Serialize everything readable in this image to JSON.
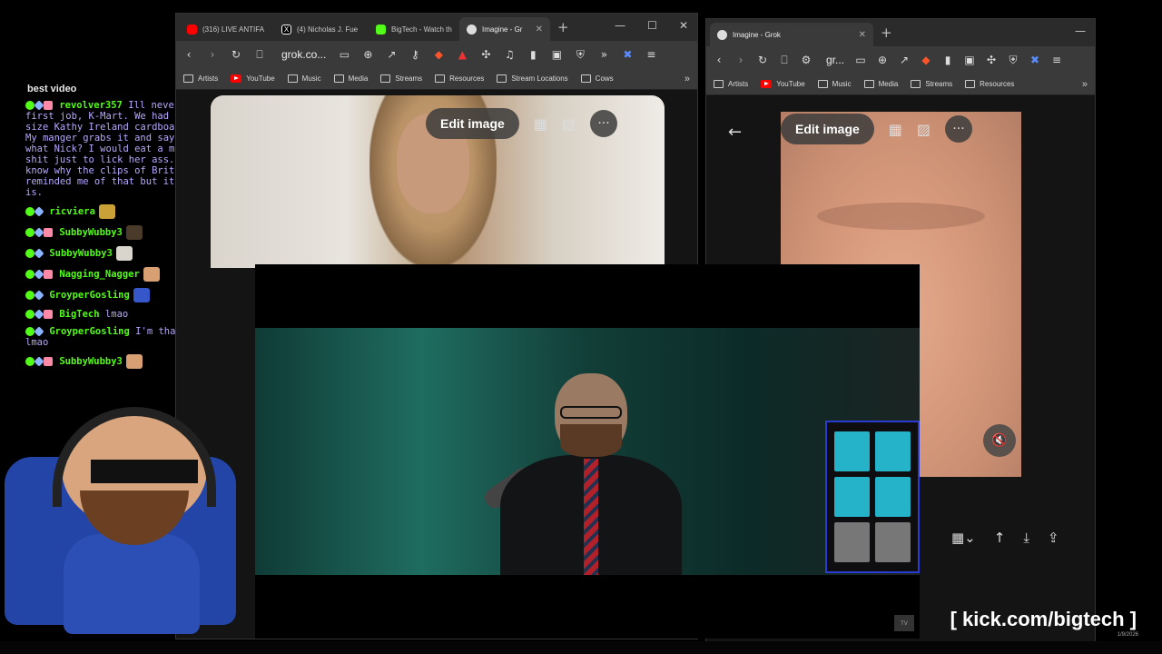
{
  "chat": {
    "header": "best video",
    "messages": [
      {
        "user": "revolver357",
        "text": "Ill never forget my first job, K-Mart. We had this life size Kathy Ireland cardboard cutout. My manger grabs it and says “you know what Nick? I would eat a mile of her shit just to lick her ass.” I don’t know why the clips of Brittany reminded me of that but it is what it is.",
        "emote": false
      },
      {
        "user": "ricviera",
        "text": "",
        "emote": true
      },
      {
        "user": "SubbyWubby3",
        "text": "",
        "emote": true
      },
      {
        "user": "SubbyWubby3",
        "text": "",
        "emote": true
      },
      {
        "user": "Nagging_Nagger",
        "text": "",
        "emote": true
      },
      {
        "user": "GroyperGosling",
        "text": "",
        "emote": true
      },
      {
        "user": "BigTech",
        "text": "lmao",
        "emote": false
      },
      {
        "user": "GroyperGosling",
        "text": "I'm that coworker lmao",
        "emote": false
      },
      {
        "user": "SubbyWubby3",
        "text": "",
        "emote": true
      }
    ]
  },
  "left_browser": {
    "tabs": [
      {
        "label": "(316) LIVE ANTIFA",
        "icon": "youtube-icon",
        "color": "#ff0000"
      },
      {
        "label": "(4) Nicholas J. Fue",
        "icon": "x-icon",
        "color": "#ffffff"
      },
      {
        "label": "BigTech - Watch th",
        "icon": "kick-icon",
        "color": "#53fc18"
      },
      {
        "label": "Imagine - Gr",
        "icon": "grok-icon",
        "color": "#dddddd",
        "active": true
      }
    ],
    "url": "grok.co...",
    "bookmarks": [
      "Artists",
      "YouTube",
      "Music",
      "Media",
      "Streams",
      "Resources",
      "Stream Locations",
      "Cows"
    ],
    "edit_image_label": "Edit image"
  },
  "right_browser": {
    "tabs": [
      {
        "label": "Imagine - Grok",
        "icon": "grok-icon",
        "color": "#dddddd",
        "active": true
      }
    ],
    "url": "gr...",
    "bookmarks": [
      "Artists",
      "YouTube",
      "Music",
      "Media",
      "Streams",
      "Resources"
    ],
    "edit_image_label": "Edit image"
  },
  "overlay": {
    "kick_url": "[ kick.com/bigtech ]",
    "clock_date": "1/9/2026"
  }
}
